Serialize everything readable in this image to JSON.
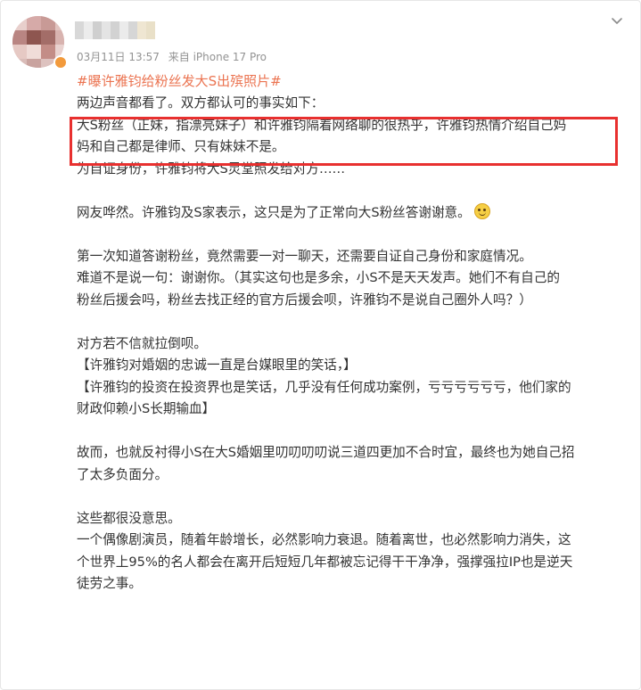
{
  "post": {
    "date": "03月11日 13:57",
    "source": "来自 iPhone 17 Pro",
    "hashtag": "#曝许雅钧给粉丝发大S出殡照片#",
    "more_icon": "chevron-down-icon",
    "lines": [
      "两边声音都看了。双方都认可的事实如下：",
      "大S粉丝（正妹，指漂亮妹子）和许雅钧隔着网络聊的很热乎，许雅钧热情介绍自己妈",
      "妈和自己都是律师、只有妹妹不是。",
      "为自证身份，许雅钧将大S灵堂照发给对方……",
      "",
      "网友哗然。许雅钧及S家表示，这只是为了正常向大S粉丝答谢谢意。",
      "",
      "第一次知道答谢粉丝，竟然需要一对一聊天，还需要自证自己身份和家庭情况。",
      "难道不是说一句：谢谢你。（其实这句也是多余，小S不是天天发声。她们不有自己的",
      "粉丝后援会吗，粉丝去找正经的官方后援会呗，许雅钧不是说自己圈外人吗？）",
      "",
      "对方若不信就拉倒呗。",
      "【许雅钧对婚姻的忠诚一直是台媒眼里的笑话，】",
      "【许雅钧的投资在投资界也是笑话，几乎没有任何成功案例，亏亏亏亏亏亏，他们家的",
      "财政仰赖小S长期输血】",
      "",
      "故而，也就反衬得小S在大S婚姻里叨叨叨叨说三道四更加不合时宜，最终也为她自己招",
      "了太多负面分。",
      "",
      "这些都很没意思。",
      "一个偶像剧演员，随着年龄增长，必然影响力衰退。随着离世，也必然影响力消失，这",
      "个世界上95%的名人都会在离开后短短几年都被忘记得干干净净，强撑强拉IP也是逆天",
      "徒劳之事。"
    ]
  },
  "colors": {
    "hashtag": "#eb7350",
    "highlight_border": "#e8302f",
    "meta": "#939393",
    "text": "#333333"
  }
}
